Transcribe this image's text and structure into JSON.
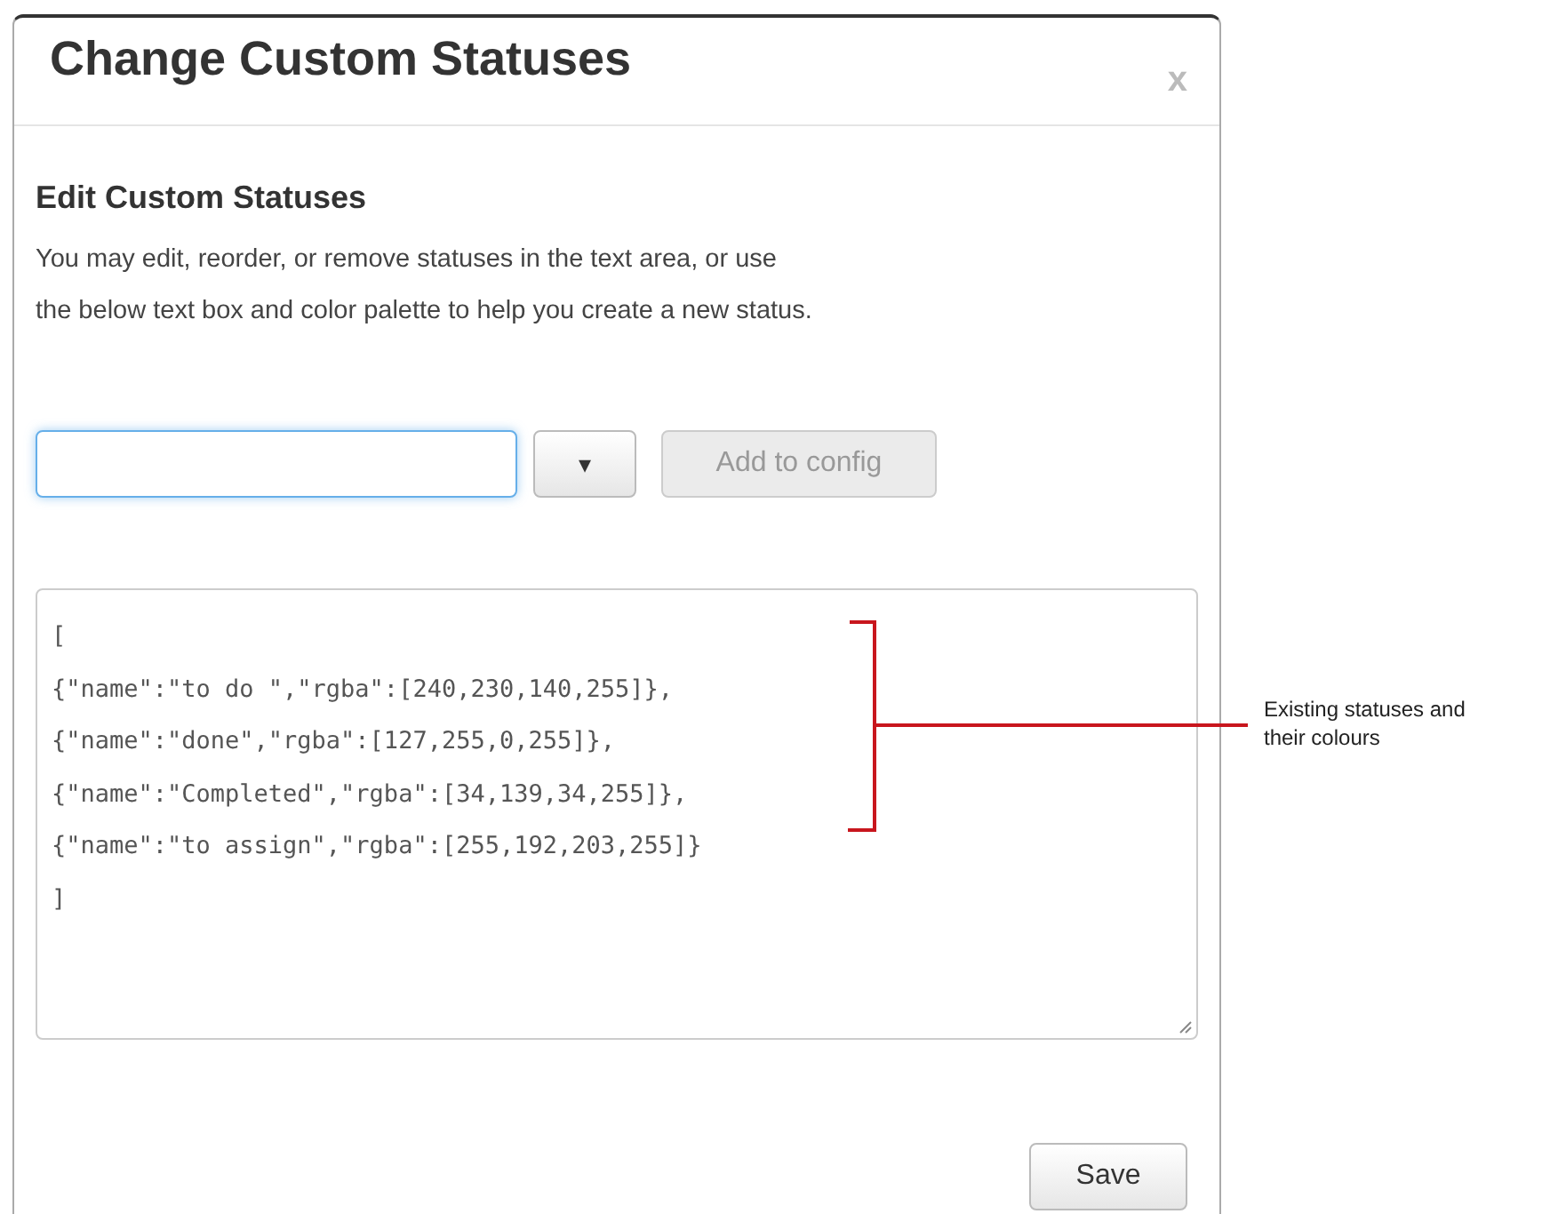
{
  "dialog": {
    "title": "Change Custom Statuses",
    "close": "x"
  },
  "section": {
    "heading": "Edit Custom Statuses",
    "description_lines": [
      "You may edit, reorder, or remove statuses in the text area, or use",
      "the below text box and color palette to help you create a new status."
    ]
  },
  "new_status": {
    "name_field": {
      "focused": true
    },
    "color_dropdown": {
      "caret": "▾"
    },
    "add_button": {
      "label": "Add to config",
      "disabled": true
    }
  },
  "config_text": {
    "lines": [
      "[",
      "{\"name\":\"to do \",\"rgba\":[240,230,140,255]},",
      "{\"name\":\"done\",\"rgba\":[127,255,0,255]},",
      "{\"name\":\"Completed\",\"rgba\":[34,139,34,255]},",
      "{\"name\":\"to assign\",\"rgba\":[255,192,203,255]}",
      "]"
    ]
  },
  "save_button": {
    "label": "Save"
  },
  "annotation": {
    "text_lines": [
      "Existing statuses and",
      "their colours"
    ]
  }
}
